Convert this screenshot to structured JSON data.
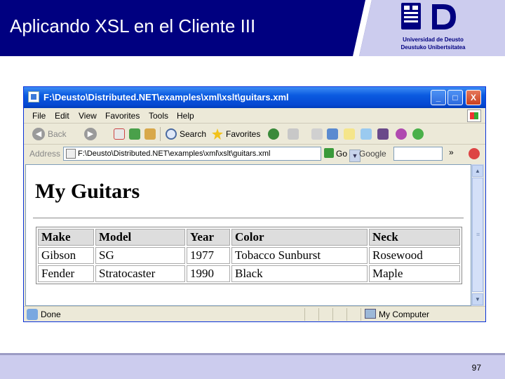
{
  "slide": {
    "title": "Aplicando XSL en el Cliente III",
    "logo_line1": "Universidad de Deusto",
    "logo_line2": "Deustuko Unibertsitatea",
    "page_number": "97"
  },
  "browser": {
    "window_title": "F:\\Deusto\\Distributed.NET\\examples\\xml\\xslt\\guitars.xml",
    "window_buttons": [
      "_",
      "□",
      "X"
    ],
    "menu": [
      "File",
      "Edit",
      "View",
      "Favorites",
      "Tools",
      "Help"
    ],
    "toolbar": {
      "back_label": "Back",
      "search_label": "Search",
      "favorites_label": "Favorites"
    },
    "address": {
      "label": "Address",
      "value": "F:\\Deusto\\Distributed.NET\\examples\\xml\\xslt\\guitars.xml",
      "go_label": "Go",
      "google_label": "Google",
      "more_chevron": "»"
    },
    "status": {
      "text": "Done",
      "zone": "My Computer"
    }
  },
  "page": {
    "heading": "My Guitars",
    "table": {
      "headers": [
        "Make",
        "Model",
        "Year",
        "Color",
        "Neck"
      ],
      "rows": [
        [
          "Gibson",
          "SG",
          "1977",
          "Tobacco Sunburst",
          "Rosewood"
        ],
        [
          "Fender",
          "Stratocaster",
          "1990",
          "Black",
          "Maple"
        ]
      ]
    }
  },
  "colors": {
    "header_blue": "#000080",
    "header_band": "#ccccee",
    "xp_titlebar": "#0548d2"
  },
  "icons": [
    "back-arrow-icon",
    "forward-arrow-icon",
    "stop-icon",
    "refresh-icon",
    "home-icon",
    "search-icon",
    "favorites-star-icon",
    "history-icon",
    "mail-icon",
    "print-icon",
    "edit-icon",
    "discuss-icon",
    "messenger-icon",
    "windows-logo-icon"
  ]
}
